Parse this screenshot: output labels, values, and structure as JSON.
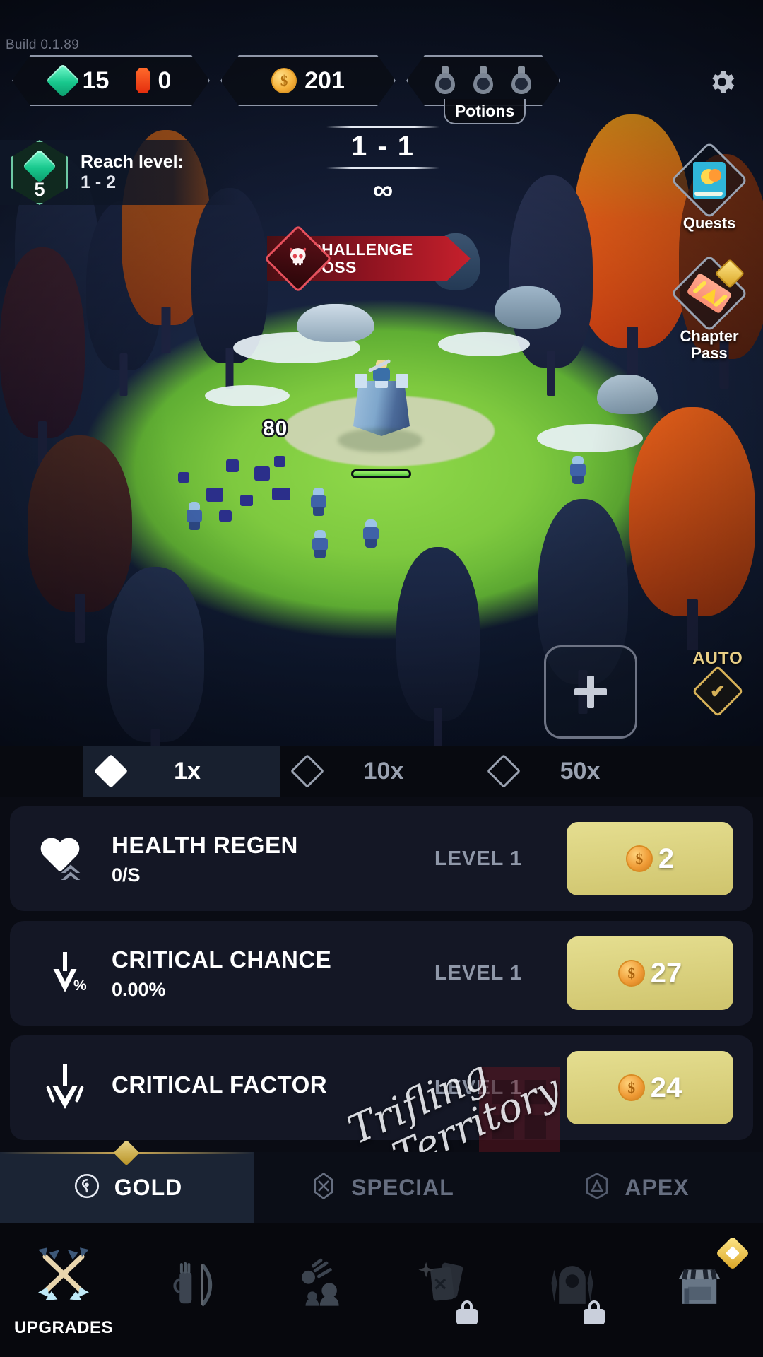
{
  "build": {
    "label": "Build 0.1.89"
  },
  "hud": {
    "gems": {
      "icon": "gem-icon",
      "value": "15"
    },
    "rubies": {
      "icon": "ruby-icon",
      "value": "0"
    },
    "gold": {
      "icon": "coin-icon",
      "value": "201"
    },
    "potions": {
      "label": "Potions",
      "icon": "potion-icon",
      "count": 3
    },
    "settings": {
      "icon": "gear-icon"
    }
  },
  "objective": {
    "badge_icon": "gem-icon",
    "badge_value": "5",
    "title": "Reach level:",
    "target": "1 - 2"
  },
  "stage": {
    "number": "1 - 1",
    "loop": "∞"
  },
  "boss": {
    "icon": "skull-icon",
    "line1": "CHALLENGE",
    "line2": "BOSS"
  },
  "side_buttons": [
    {
      "name": "quests",
      "icon": "quest-book-icon",
      "label": "Quests"
    },
    {
      "name": "chapter-pass",
      "icon": "ticket-icon",
      "label_line1": "Chapter",
      "label_line2": "Pass"
    }
  ],
  "battle": {
    "damage_number": "80",
    "health_percent": 100,
    "add_button_icon": "plus-icon",
    "auto": {
      "label": "AUTO",
      "icon": "check-icon"
    }
  },
  "multipliers": [
    {
      "label": "1x",
      "active": true
    },
    {
      "label": "10x",
      "active": false
    },
    {
      "label": "50x",
      "active": false
    }
  ],
  "upgrades": [
    {
      "icon": "heart-up-icon",
      "name": "HEALTH REGEN",
      "value": "0/S",
      "level": "LEVEL 1",
      "price": "2",
      "currency_icon": "coin-icon"
    },
    {
      "icon": "crit-chance-icon",
      "name": "CRITICAL CHANCE",
      "value": "0.00%",
      "level": "LEVEL 1",
      "price": "27",
      "currency_icon": "coin-icon"
    },
    {
      "icon": "crit-factor-icon",
      "name": "CRITICAL FACTOR",
      "value": "",
      "level": "LEVEL 1",
      "price": "24",
      "currency_icon": "coin-icon"
    }
  ],
  "categories": [
    {
      "label": "GOLD",
      "icon": "gold-ring-icon",
      "active": true
    },
    {
      "label": "SPECIAL",
      "icon": "special-gem-icon",
      "active": false
    },
    {
      "label": "APEX",
      "icon": "apex-icon",
      "active": false
    }
  ],
  "nav": [
    {
      "icon": "crossed-arrows-icon",
      "label": "UPGRADES",
      "active": true,
      "locked": false,
      "badge": false
    },
    {
      "icon": "bow-quiver-icon",
      "label": "",
      "active": false,
      "locked": false,
      "badge": false
    },
    {
      "icon": "meteor-heroes-icon",
      "label": "",
      "active": false,
      "locked": false,
      "badge": false
    },
    {
      "icon": "cards-icon",
      "label": "",
      "active": false,
      "locked": true,
      "badge": false
    },
    {
      "icon": "gate-icon",
      "label": "",
      "active": false,
      "locked": true,
      "badge": false
    },
    {
      "icon": "shop-icon",
      "label": "",
      "active": false,
      "locked": false,
      "badge": true
    }
  ],
  "watermark": {
    "line1": "Trifling",
    "line2": "Territory"
  },
  "colors": {
    "gem_green": "#18c88d",
    "ruby_red": "#e42d0d",
    "gold": "#f5b23c",
    "boss_red": "#c6202c",
    "buy_button": "#cfc46d",
    "accent_gold": "#d6b158",
    "panel_dark": "#141725"
  }
}
